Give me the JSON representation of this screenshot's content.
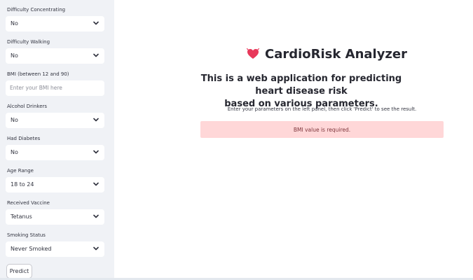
{
  "sidebar": {
    "difficulty_concentrating": {
      "label": "Difficulty Concentrating",
      "value": "No"
    },
    "difficulty_walking": {
      "label": "Difficulty Walking",
      "value": "No"
    },
    "bmi": {
      "label": "BMI (between 12 and 90)",
      "placeholder": "Enter your BMI here"
    },
    "alcohol_drinkers": {
      "label": "Alcohol Drinkers",
      "value": "No"
    },
    "had_diabetes": {
      "label": "Had Diabetes",
      "value": "No"
    },
    "age_range": {
      "label": "Age Range",
      "value": "18 to 24"
    },
    "received_vaccine": {
      "label": "Received Vaccine",
      "value": "Tetanus"
    },
    "smoking_status": {
      "label": "Smoking Status",
      "value": "Never Smoked"
    },
    "predict_label": "Predict"
  },
  "main": {
    "title": "CardioRisk Analyzer",
    "subtitle_line1": "This is a web application for predicting heart disease risk",
    "subtitle_line2": "based on various parameters.",
    "instructions": "Enter your parameters on the left panel, then click 'Predict' to see the result.",
    "error_message": "BMI value is required."
  },
  "icons": {
    "heart": "heart-icon",
    "chevron": "chevron-down-icon"
  },
  "colors": {
    "sidebar_bg": "#f0f2f6",
    "heart": "#e8385a",
    "error_bg": "#ffd7d8",
    "error_text": "#7d353b"
  }
}
